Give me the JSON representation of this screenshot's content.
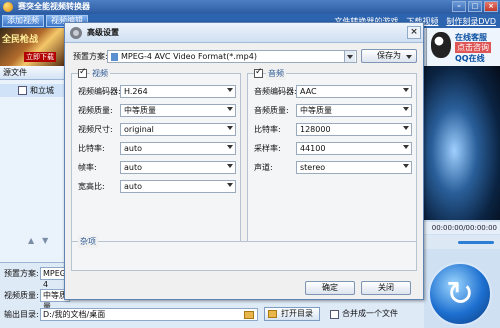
{
  "app": {
    "title": "赛突全能视频转换器",
    "toolbar": {
      "add_video": "添加视频",
      "edit_video": "视频编辑"
    },
    "links": [
      "文件转换器的游戏",
      "下载视频",
      "制作刻录DVD"
    ],
    "banner_left": {
      "text": "全民枪战",
      "sub": "立即下载"
    },
    "banner_right": {
      "line1": "在线客服",
      "line2": "点击咨询",
      "line3": "QQ在线"
    },
    "file_list": {
      "header": "源文件",
      "item": "和立城"
    },
    "player": {
      "time": "00:00:00/00:00:00"
    },
    "bottom": {
      "preset_label": "预置方案:",
      "preset_value": "MPEG-4",
      "quality_label": "视频质量:",
      "quality_value": "中等质量",
      "output_label": "输出目录:",
      "output_value": "D:/我的文档/桌面",
      "open_dir": "打开目录",
      "merge": "合并成一个文件"
    }
  },
  "dialog": {
    "title": "高级设置",
    "close": "×",
    "preset_label": "预置方案:",
    "preset_value": "MPEG-4 AVC Video Format(*.mp4)",
    "save_as": "保存为",
    "video": {
      "header": "视频",
      "rows": [
        {
          "label": "视频编码器:",
          "value": "H.264"
        },
        {
          "label": "视频质量:",
          "value": "中等质量"
        },
        {
          "label": "视频尺寸:",
          "value": "original"
        },
        {
          "label": "比特率:",
          "value": "auto"
        },
        {
          "label": "帧率:",
          "value": "auto"
        },
        {
          "label": "宽高比:",
          "value": "auto"
        }
      ]
    },
    "audio": {
      "header": "音频",
      "rows": [
        {
          "label": "音频编码器:",
          "value": "AAC"
        },
        {
          "label": "音频质量:",
          "value": "中等质量"
        },
        {
          "label": "比特率:",
          "value": "128000"
        },
        {
          "label": "采样率:",
          "value": "44100"
        },
        {
          "label": "声道:",
          "value": "stereo"
        }
      ]
    },
    "misc": {
      "header": "杂项"
    },
    "ok": "确定",
    "cancel": "关闭"
  }
}
